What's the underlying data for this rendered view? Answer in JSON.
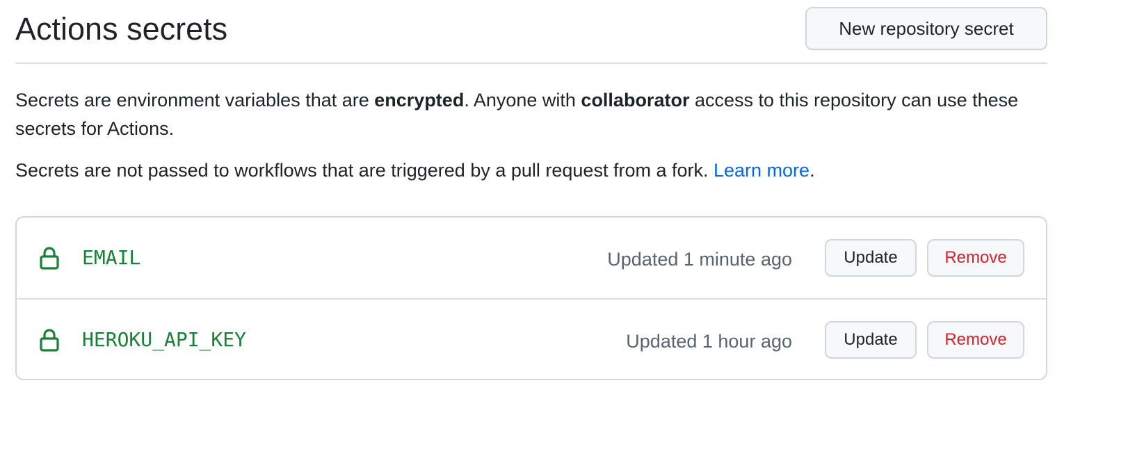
{
  "header": {
    "title": "Actions secrets",
    "new_secret_label": "New repository secret"
  },
  "description": {
    "p1_before": "Secrets are environment variables that are ",
    "p1_bold1": "encrypted",
    "p1_middle": ". Anyone with ",
    "p1_bold2": "collaborator",
    "p1_after": " access to this repository can use these secrets for Actions.",
    "p2_text": "Secrets are not passed to workflows that are triggered by a pull request from a fork. ",
    "p2_link": "Learn more",
    "p2_end": "."
  },
  "secrets": [
    {
      "name": "EMAIL",
      "updated": "Updated 1 minute ago",
      "update_label": "Update",
      "remove_label": "Remove"
    },
    {
      "name": "HEROKU_API_KEY",
      "updated": "Updated 1 hour ago",
      "update_label": "Update",
      "remove_label": "Remove"
    }
  ],
  "icons": {
    "lock": "lock-icon"
  },
  "colors": {
    "secret_name": "#1a7f37",
    "link": "#0969da",
    "danger": "#d1242f",
    "muted": "#59636e"
  }
}
